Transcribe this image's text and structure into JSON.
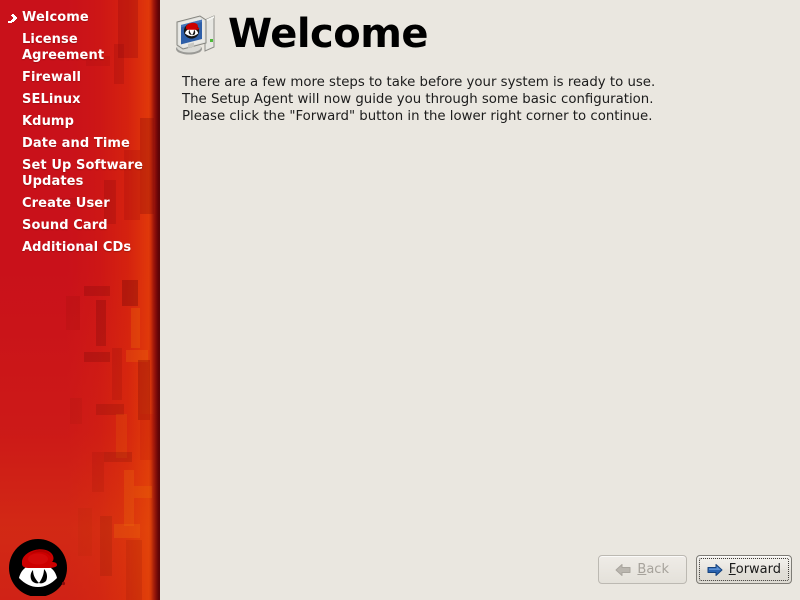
{
  "colors": {
    "sidebar_red": "#cc1212",
    "sidebar_edge_dark": "#5d0407",
    "content_bg": "#eae7e0",
    "nav_text": "#ffffff",
    "title_text": "#000000",
    "body_text": "#1c1c1c",
    "forward_arrow_blue": "#2a63b0",
    "back_arrow_gray": "#b3afa8",
    "redhat_hat_red": "#cc0000",
    "redhat_circle_black": "#000000"
  },
  "sidebar": {
    "name": "setup-agent-steps",
    "bullet_icon": "arrow-right-bullet-icon",
    "logo_icon": "red-hat-shadowman-logo",
    "items": [
      {
        "label": "Welcome",
        "current": true
      },
      {
        "label": "License Agreement",
        "current": false
      },
      {
        "label": "Firewall",
        "current": false
      },
      {
        "label": "SELinux",
        "current": false
      },
      {
        "label": "Kdump",
        "current": false
      },
      {
        "label": "Date and Time",
        "current": false
      },
      {
        "label": "Set Up Software Updates",
        "current": false
      },
      {
        "label": "Create User",
        "current": false
      },
      {
        "label": "Sound Card",
        "current": false
      },
      {
        "label": "Additional CDs",
        "current": false
      }
    ]
  },
  "header": {
    "icon": "computer-redhat-icon",
    "title": "Welcome"
  },
  "main": {
    "body_text": "There are a few more steps to take before your system is ready to use.  The Setup Agent will now guide you through some basic configuration.  Please click the \"Forward\" button in the lower right corner to continue."
  },
  "buttons": {
    "back": {
      "label_before": "",
      "mnemonic": "B",
      "label_after": "ack",
      "icon": "arrow-left-icon",
      "disabled": true,
      "focused": false
    },
    "forward": {
      "label_before": "",
      "mnemonic": "F",
      "label_after": "orward",
      "icon": "arrow-right-icon",
      "disabled": false,
      "focused": true
    }
  }
}
